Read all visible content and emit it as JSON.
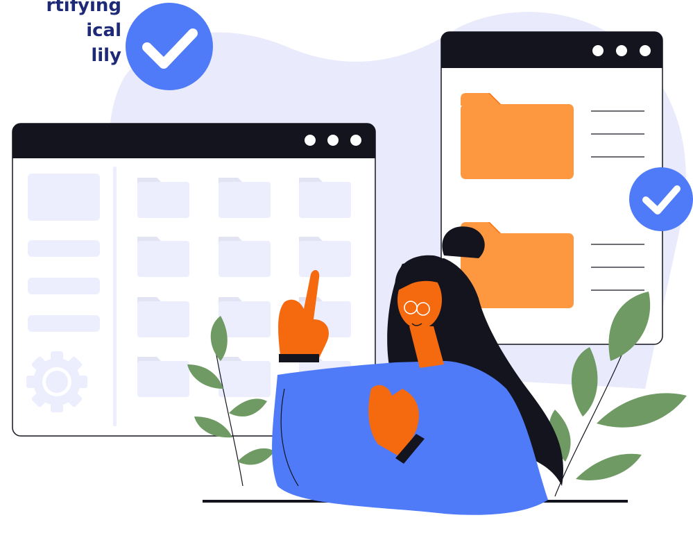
{
  "headline": {
    "lines": [
      "rtifying",
      "ical",
      "lily"
    ]
  },
  "colors": {
    "headline": "#1e2a78",
    "blob": "#e9eafb",
    "window_bar": "#14141f",
    "window_body": "#ffffff",
    "placeholder": "#eceefd",
    "folder_front": "#fd9841",
    "folder_back": "#fb6e0b",
    "check_badge": "#4f7bf9",
    "sweater": "#4f7bf9",
    "skin": "#f56a0f",
    "hair": "#14141f",
    "leaf": "#6f9a63",
    "ground": "#14141f"
  },
  "icons": {
    "check_large": "check-icon",
    "check_small": "check-icon",
    "settings": "gear-icon",
    "window_controls": "three-dots-icon"
  }
}
